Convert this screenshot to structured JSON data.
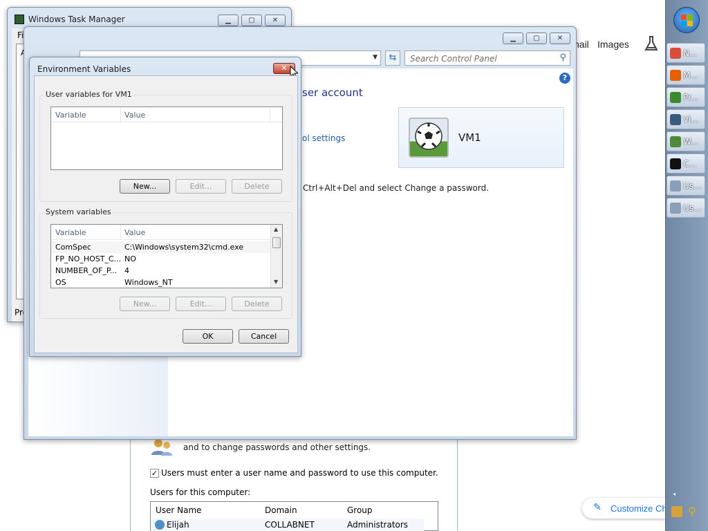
{
  "task_manager": {
    "title": "Windows Task Manager",
    "menu_stub": "Fi",
    "tab_stub": "Pro",
    "stub_a": "A"
  },
  "control_panel": {
    "search_placeholder": "Search Control Panel",
    "heading_fragment": "ser account",
    "link_fragment": "ol settings",
    "user_name": "VM1",
    "password_text": "Ctrl+Alt+Del and select Change a password."
  },
  "browser_bg": {
    "links": [
      "nail",
      "Images"
    ]
  },
  "user_accounts": {
    "desc_line": "and to change passwords and other settings.",
    "checkbox_label": "Users must enter a user name and password to use this computer.",
    "users_label": "Users for this computer:",
    "columns": [
      "User Name",
      "Domain",
      "Group"
    ],
    "rows": [
      {
        "user": "Elijah",
        "domain": "COLLABNET",
        "group": "Administrators"
      }
    ]
  },
  "env_dialog": {
    "title": "Environment Variables",
    "user_group_label": "User variables for VM1",
    "system_group_label": "System variables",
    "col_variable": "Variable",
    "col_value": "Value",
    "system_vars": [
      {
        "name": "ComSpec",
        "value": "C:\\Windows\\system32\\cmd.exe"
      },
      {
        "name": "FP_NO_HOST_C...",
        "value": "NO"
      },
      {
        "name": "NUMBER_OF_P...",
        "value": "4"
      },
      {
        "name": "OS",
        "value": "Windows_NT"
      }
    ],
    "new_label": "New...",
    "edit_label": "Edit...",
    "delete_label": "Delete",
    "ok_label": "OK",
    "cancel_label": "Cancel"
  },
  "taskbar": {
    "items": [
      {
        "label": "N...",
        "color": "#dd4b39"
      },
      {
        "label": "M...",
        "color": "#e66000"
      },
      {
        "label": "Pr...",
        "color": "#3a8a2e"
      },
      {
        "label": "Vi...",
        "color": "#3b5b7d"
      },
      {
        "label": "W...",
        "color": "#4c8a3a"
      },
      {
        "label": "C...",
        "color": "#111111"
      },
      {
        "label": "Us...",
        "color": "#8aa0b8"
      },
      {
        "label": "Us...",
        "color": "#8aa0b8"
      }
    ]
  },
  "customize": {
    "label": "Customize Ch"
  },
  "colors": {
    "link_blue": "#1e5aa8",
    "dialog_bg": "#f0f0f0",
    "taskbar": "#7d93ad"
  }
}
